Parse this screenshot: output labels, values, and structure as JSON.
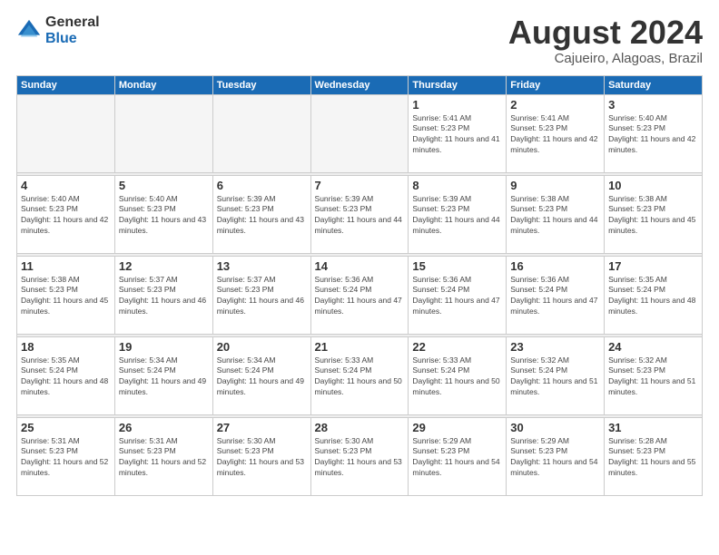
{
  "header": {
    "logo_general": "General",
    "logo_blue": "Blue",
    "month_title": "August 2024",
    "location": "Cajueiro, Alagoas, Brazil"
  },
  "days_of_week": [
    "Sunday",
    "Monday",
    "Tuesday",
    "Wednesday",
    "Thursday",
    "Friday",
    "Saturday"
  ],
  "weeks": [
    [
      {
        "day": "",
        "empty": true
      },
      {
        "day": "",
        "empty": true
      },
      {
        "day": "",
        "empty": true
      },
      {
        "day": "",
        "empty": true
      },
      {
        "day": "1",
        "sunrise": "Sunrise: 5:41 AM",
        "sunset": "Sunset: 5:23 PM",
        "daylight": "Daylight: 11 hours and 41 minutes."
      },
      {
        "day": "2",
        "sunrise": "Sunrise: 5:41 AM",
        "sunset": "Sunset: 5:23 PM",
        "daylight": "Daylight: 11 hours and 42 minutes."
      },
      {
        "day": "3",
        "sunrise": "Sunrise: 5:40 AM",
        "sunset": "Sunset: 5:23 PM",
        "daylight": "Daylight: 11 hours and 42 minutes."
      }
    ],
    [
      {
        "day": "4",
        "sunrise": "Sunrise: 5:40 AM",
        "sunset": "Sunset: 5:23 PM",
        "daylight": "Daylight: 11 hours and 42 minutes."
      },
      {
        "day": "5",
        "sunrise": "Sunrise: 5:40 AM",
        "sunset": "Sunset: 5:23 PM",
        "daylight": "Daylight: 11 hours and 43 minutes."
      },
      {
        "day": "6",
        "sunrise": "Sunrise: 5:39 AM",
        "sunset": "Sunset: 5:23 PM",
        "daylight": "Daylight: 11 hours and 43 minutes."
      },
      {
        "day": "7",
        "sunrise": "Sunrise: 5:39 AM",
        "sunset": "Sunset: 5:23 PM",
        "daylight": "Daylight: 11 hours and 44 minutes."
      },
      {
        "day": "8",
        "sunrise": "Sunrise: 5:39 AM",
        "sunset": "Sunset: 5:23 PM",
        "daylight": "Daylight: 11 hours and 44 minutes."
      },
      {
        "day": "9",
        "sunrise": "Sunrise: 5:38 AM",
        "sunset": "Sunset: 5:23 PM",
        "daylight": "Daylight: 11 hours and 44 minutes."
      },
      {
        "day": "10",
        "sunrise": "Sunrise: 5:38 AM",
        "sunset": "Sunset: 5:23 PM",
        "daylight": "Daylight: 11 hours and 45 minutes."
      }
    ],
    [
      {
        "day": "11",
        "sunrise": "Sunrise: 5:38 AM",
        "sunset": "Sunset: 5:23 PM",
        "daylight": "Daylight: 11 hours and 45 minutes."
      },
      {
        "day": "12",
        "sunrise": "Sunrise: 5:37 AM",
        "sunset": "Sunset: 5:23 PM",
        "daylight": "Daylight: 11 hours and 46 minutes."
      },
      {
        "day": "13",
        "sunrise": "Sunrise: 5:37 AM",
        "sunset": "Sunset: 5:23 PM",
        "daylight": "Daylight: 11 hours and 46 minutes."
      },
      {
        "day": "14",
        "sunrise": "Sunrise: 5:36 AM",
        "sunset": "Sunset: 5:24 PM",
        "daylight": "Daylight: 11 hours and 47 minutes."
      },
      {
        "day": "15",
        "sunrise": "Sunrise: 5:36 AM",
        "sunset": "Sunset: 5:24 PM",
        "daylight": "Daylight: 11 hours and 47 minutes."
      },
      {
        "day": "16",
        "sunrise": "Sunrise: 5:36 AM",
        "sunset": "Sunset: 5:24 PM",
        "daylight": "Daylight: 11 hours and 47 minutes."
      },
      {
        "day": "17",
        "sunrise": "Sunrise: 5:35 AM",
        "sunset": "Sunset: 5:24 PM",
        "daylight": "Daylight: 11 hours and 48 minutes."
      }
    ],
    [
      {
        "day": "18",
        "sunrise": "Sunrise: 5:35 AM",
        "sunset": "Sunset: 5:24 PM",
        "daylight": "Daylight: 11 hours and 48 minutes."
      },
      {
        "day": "19",
        "sunrise": "Sunrise: 5:34 AM",
        "sunset": "Sunset: 5:24 PM",
        "daylight": "Daylight: 11 hours and 49 minutes."
      },
      {
        "day": "20",
        "sunrise": "Sunrise: 5:34 AM",
        "sunset": "Sunset: 5:24 PM",
        "daylight": "Daylight: 11 hours and 49 minutes."
      },
      {
        "day": "21",
        "sunrise": "Sunrise: 5:33 AM",
        "sunset": "Sunset: 5:24 PM",
        "daylight": "Daylight: 11 hours and 50 minutes."
      },
      {
        "day": "22",
        "sunrise": "Sunrise: 5:33 AM",
        "sunset": "Sunset: 5:24 PM",
        "daylight": "Daylight: 11 hours and 50 minutes."
      },
      {
        "day": "23",
        "sunrise": "Sunrise: 5:32 AM",
        "sunset": "Sunset: 5:24 PM",
        "daylight": "Daylight: 11 hours and 51 minutes."
      },
      {
        "day": "24",
        "sunrise": "Sunrise: 5:32 AM",
        "sunset": "Sunset: 5:23 PM",
        "daylight": "Daylight: 11 hours and 51 minutes."
      }
    ],
    [
      {
        "day": "25",
        "sunrise": "Sunrise: 5:31 AM",
        "sunset": "Sunset: 5:23 PM",
        "daylight": "Daylight: 11 hours and 52 minutes."
      },
      {
        "day": "26",
        "sunrise": "Sunrise: 5:31 AM",
        "sunset": "Sunset: 5:23 PM",
        "daylight": "Daylight: 11 hours and 52 minutes."
      },
      {
        "day": "27",
        "sunrise": "Sunrise: 5:30 AM",
        "sunset": "Sunset: 5:23 PM",
        "daylight": "Daylight: 11 hours and 53 minutes."
      },
      {
        "day": "28",
        "sunrise": "Sunrise: 5:30 AM",
        "sunset": "Sunset: 5:23 PM",
        "daylight": "Daylight: 11 hours and 53 minutes."
      },
      {
        "day": "29",
        "sunrise": "Sunrise: 5:29 AM",
        "sunset": "Sunset: 5:23 PM",
        "daylight": "Daylight: 11 hours and 54 minutes."
      },
      {
        "day": "30",
        "sunrise": "Sunrise: 5:29 AM",
        "sunset": "Sunset: 5:23 PM",
        "daylight": "Daylight: 11 hours and 54 minutes."
      },
      {
        "day": "31",
        "sunrise": "Sunrise: 5:28 AM",
        "sunset": "Sunset: 5:23 PM",
        "daylight": "Daylight: 11 hours and 55 minutes."
      }
    ]
  ]
}
